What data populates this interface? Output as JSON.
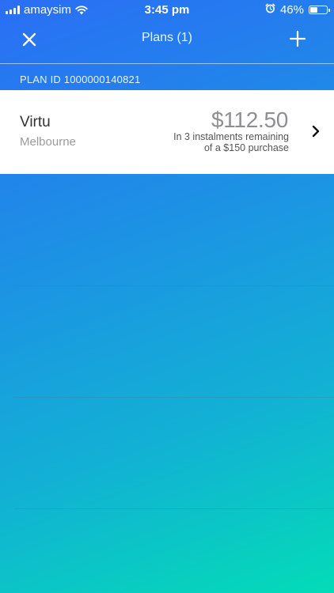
{
  "status_bar": {
    "carrier": "amaysim",
    "time": "3:45 pm",
    "battery_percent": "46%",
    "battery_level": 0.46,
    "icons": [
      "signal-icon",
      "wifi-icon",
      "alarm-icon",
      "battery-icon"
    ]
  },
  "nav": {
    "title": "Plans (1)",
    "close_icon": "close-icon",
    "add_icon": "plus-icon"
  },
  "plan": {
    "id_label": "PLAN ID 1000000140821",
    "merchant": "Virtu",
    "location": "Melbourne",
    "amount": "$112.50",
    "instalments_line1": "In 3 instalments remaining",
    "instalments_line2": "of a $150 purchase",
    "chevron_icon": "chevron-right-icon"
  },
  "colors": {
    "gradient_start": "#2a6ef5",
    "gradient_end": "#03dcb7",
    "card_background": "#ffffff"
  }
}
